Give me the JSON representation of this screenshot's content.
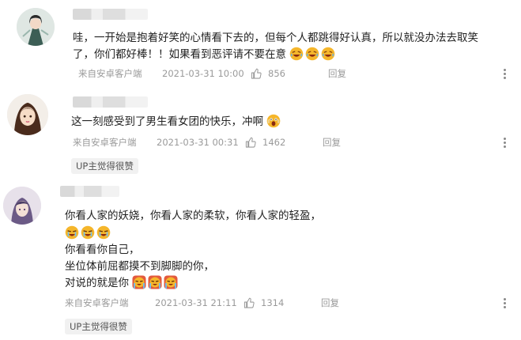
{
  "comments": [
    {
      "avatar_icon": "avatar-ancient-costume-girl-icon",
      "lines": [
        "哇，一开始是抱着好笑的心情看下去的，但每个人都跳得好认真，所以就没办法去取笑",
        "了，你们都好棒！！如果看到恶评请不要在意"
      ],
      "source": "来自安卓客户端",
      "date": "2021-03-31 10:00",
      "likes": "856",
      "reply_label": "回复",
      "emoji_names": [
        "laugh-cry-emoji",
        "laugh-cry-emoji",
        "laugh-cry-emoji"
      ]
    },
    {
      "avatar_icon": "avatar-anime-girl-icon",
      "lines": [
        "这一刻感受到了男生看女团的快乐，冲啊"
      ],
      "source": "来自安卓客户端",
      "date": "2021-03-31 00:31",
      "likes": "1462",
      "reply_label": "回复",
      "up_tag": "UP主觉得很赞",
      "emoji_names": [
        "shocked-emoji"
      ]
    },
    {
      "avatar_icon": "avatar-purple-hair-boy-icon",
      "lines": [
        "你看人家的妖娆，你看人家的柔软，你看人家的轻盈，",
        "",
        "你看看你自己，",
        "坐位体前屈都摸不到脚脚的你，",
        "对说的就是你"
      ],
      "source": "来自安卓客户端",
      "date": "2021-03-31 21:11",
      "likes": "1314",
      "reply_label": "回复",
      "up_tag": "UP主觉得很赞",
      "emoji_names": [
        "crying-laugh-emoji",
        "crying-laugh-emoji",
        "crying-laugh-emoji",
        "crying-emoji",
        "crying-emoji",
        "crying-emoji"
      ]
    }
  ],
  "colors": {
    "meta": "#9a9a9a",
    "tag_bg": "#f1f1f1"
  }
}
